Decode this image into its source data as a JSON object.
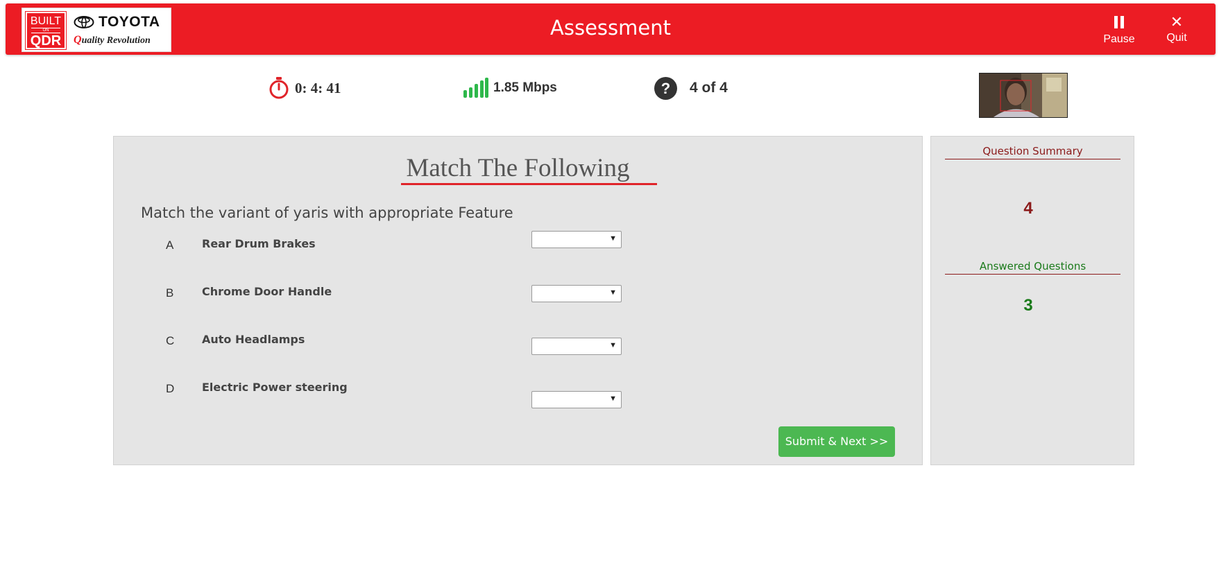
{
  "header": {
    "logo": {
      "built_text": "BUILT",
      "on_text": "ON",
      "qdr_text": "QDR",
      "brand": "TOYOTA",
      "tagline_q": "Q",
      "tagline_rest": "uality Revolution"
    },
    "title": "Assessment",
    "pause_label": "Pause",
    "quit_label": "Quit",
    "colors": {
      "bar": "#ec1c24"
    }
  },
  "status": {
    "timer": "0: 4: 41",
    "speed": "1.85 Mbps",
    "question_progress": "4 of 4",
    "icons": [
      "stopwatch-icon",
      "signal-bars-icon",
      "question-circle-icon"
    ]
  },
  "question": {
    "type_title": "Match The Following",
    "text": "Match the variant of yaris with appropriate Feature",
    "rows": [
      {
        "letter": "A",
        "label": "Rear Drum Brakes",
        "selected": ""
      },
      {
        "letter": "B",
        "label": "Chrome Door Handle",
        "selected": ""
      },
      {
        "letter": "C",
        "label": "Auto Headlamps",
        "selected": ""
      },
      {
        "letter": "D",
        "label": "Electric Power steering",
        "selected": ""
      }
    ],
    "submit_label": "Submit & Next   >>"
  },
  "summary": {
    "title": "Question Summary",
    "total": "4",
    "answered_title": "Answered Questions",
    "answered": "3"
  }
}
